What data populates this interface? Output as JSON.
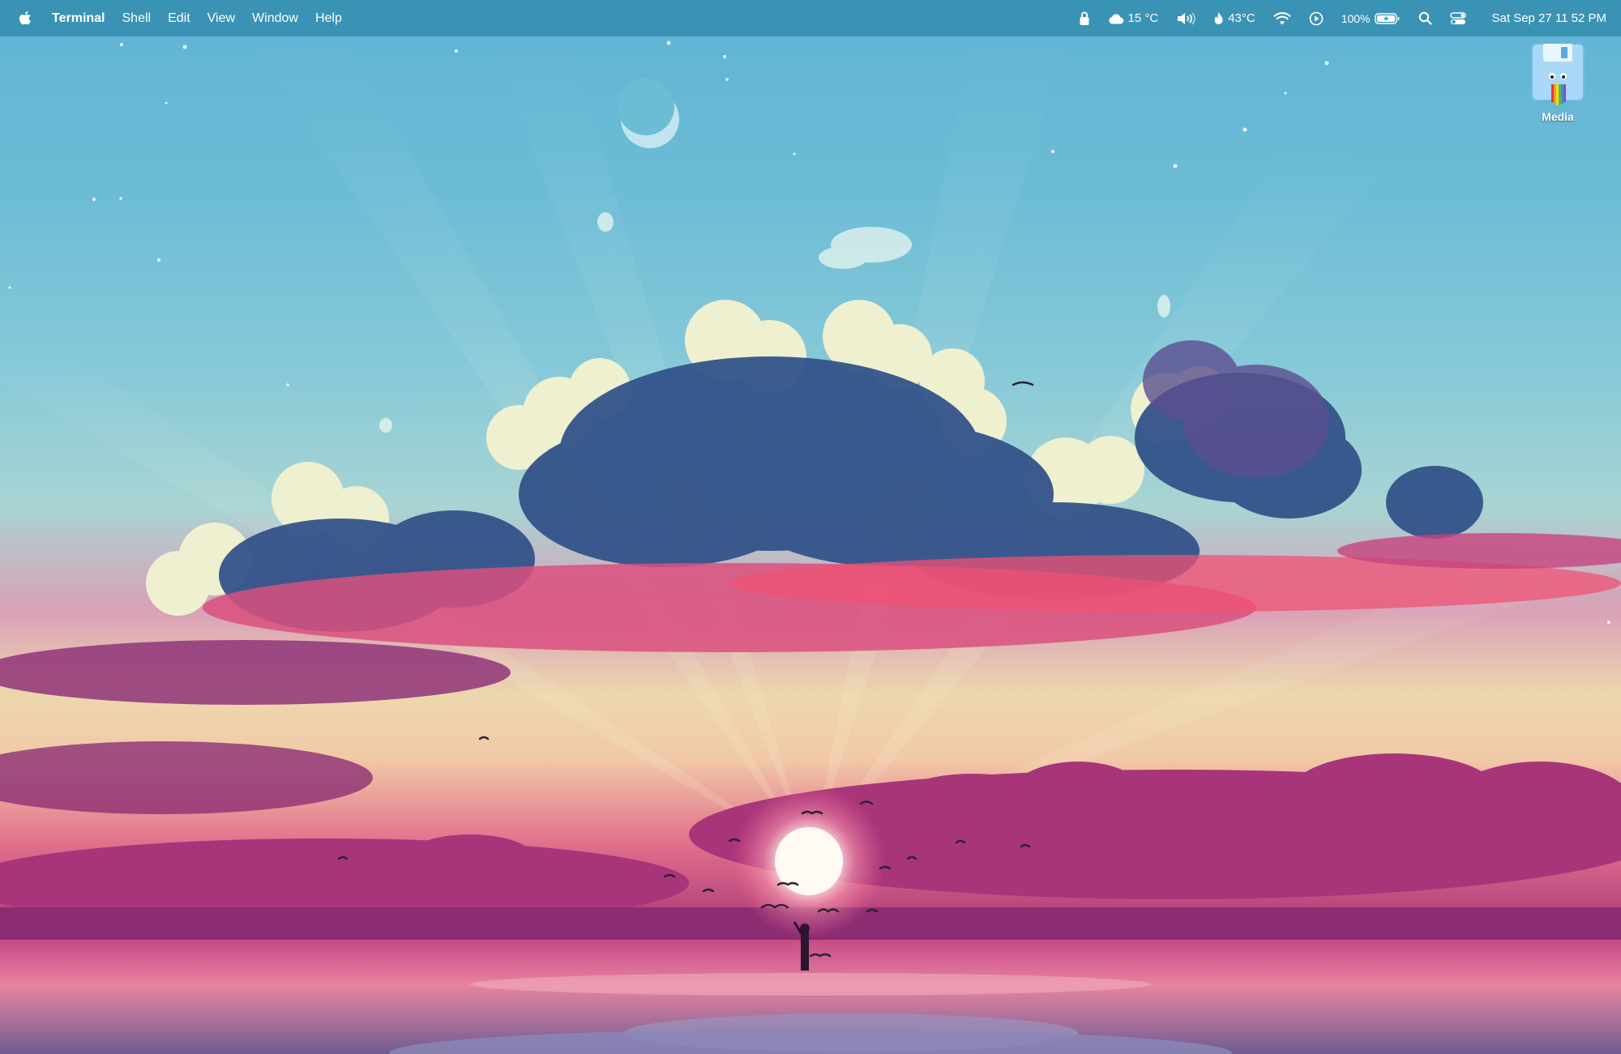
{
  "menubar": {
    "app_name": "Terminal",
    "menus": [
      "Shell",
      "Edit",
      "View",
      "Window",
      "Help"
    ],
    "status": {
      "weather": "15 °C",
      "temperature": "43°C",
      "battery_percent": "100%",
      "datetime": "Sat Sep 27  11 52 PM"
    },
    "icons": [
      "apple-icon",
      "lock-icon",
      "cloud-icon",
      "volume-icon",
      "flame-icon",
      "wifi-icon",
      "play-circle-icon",
      "battery-icon",
      "search-icon",
      "control-center-icon"
    ]
  },
  "desktop": {
    "icons": [
      {
        "label": "Media",
        "icon": "floppy-disk-icon"
      }
    ]
  },
  "colors": {
    "menubar_bg": "#348eb0",
    "sky_top": "#5fb3d3",
    "cloud_shadow": "#2e4f85",
    "sunset_magenta": "#b2417d",
    "sun": "#fff6ee"
  }
}
